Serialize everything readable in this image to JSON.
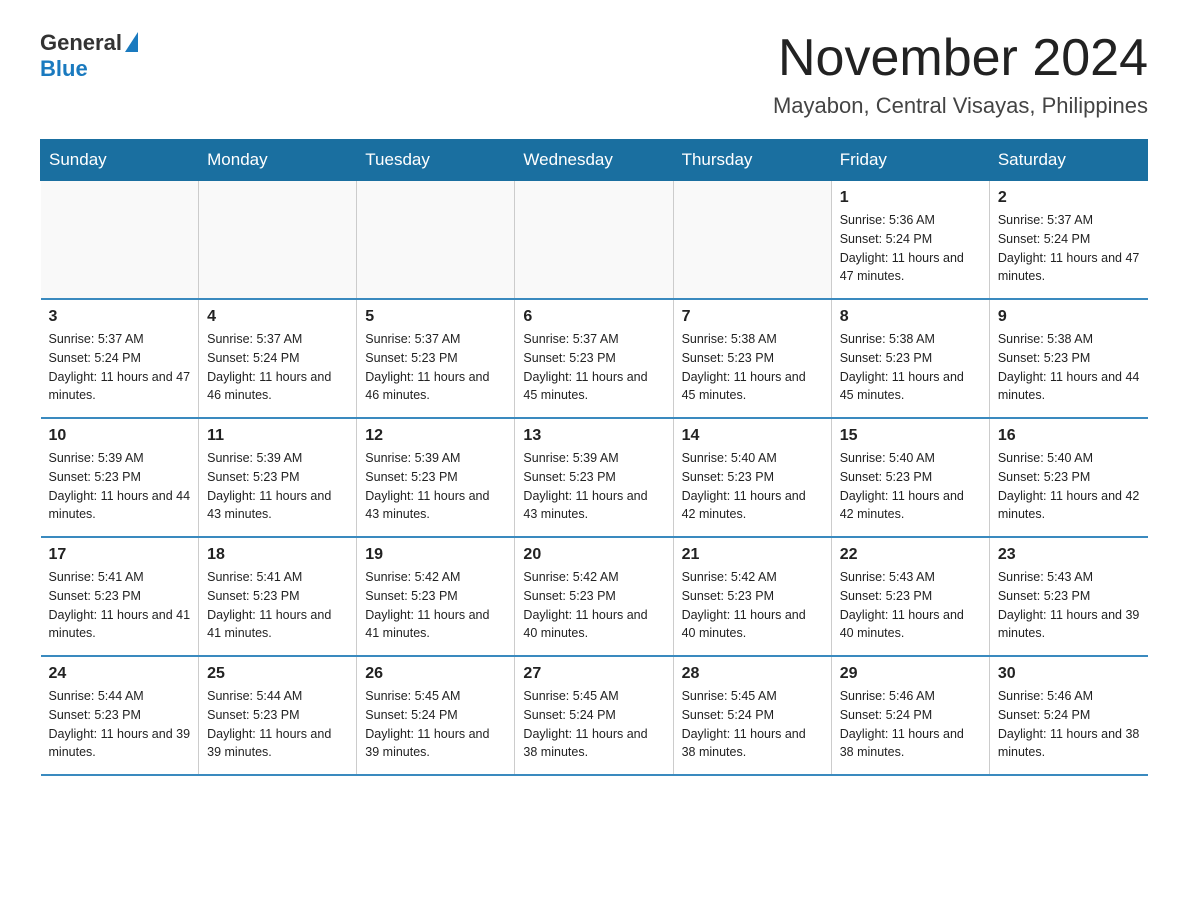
{
  "header": {
    "logo_general": "General",
    "logo_blue": "Blue",
    "month_title": "November 2024",
    "location": "Mayabon, Central Visayas, Philippines"
  },
  "weekdays": [
    "Sunday",
    "Monday",
    "Tuesday",
    "Wednesday",
    "Thursday",
    "Friday",
    "Saturday"
  ],
  "weeks": [
    [
      {
        "day": "",
        "sunrise": "",
        "sunset": "",
        "daylight": ""
      },
      {
        "day": "",
        "sunrise": "",
        "sunset": "",
        "daylight": ""
      },
      {
        "day": "",
        "sunrise": "",
        "sunset": "",
        "daylight": ""
      },
      {
        "day": "",
        "sunrise": "",
        "sunset": "",
        "daylight": ""
      },
      {
        "day": "",
        "sunrise": "",
        "sunset": "",
        "daylight": ""
      },
      {
        "day": "1",
        "sunrise": "Sunrise: 5:36 AM",
        "sunset": "Sunset: 5:24 PM",
        "daylight": "Daylight: 11 hours and 47 minutes."
      },
      {
        "day": "2",
        "sunrise": "Sunrise: 5:37 AM",
        "sunset": "Sunset: 5:24 PM",
        "daylight": "Daylight: 11 hours and 47 minutes."
      }
    ],
    [
      {
        "day": "3",
        "sunrise": "Sunrise: 5:37 AM",
        "sunset": "Sunset: 5:24 PM",
        "daylight": "Daylight: 11 hours and 47 minutes."
      },
      {
        "day": "4",
        "sunrise": "Sunrise: 5:37 AM",
        "sunset": "Sunset: 5:24 PM",
        "daylight": "Daylight: 11 hours and 46 minutes."
      },
      {
        "day": "5",
        "sunrise": "Sunrise: 5:37 AM",
        "sunset": "Sunset: 5:23 PM",
        "daylight": "Daylight: 11 hours and 46 minutes."
      },
      {
        "day": "6",
        "sunrise": "Sunrise: 5:37 AM",
        "sunset": "Sunset: 5:23 PM",
        "daylight": "Daylight: 11 hours and 45 minutes."
      },
      {
        "day": "7",
        "sunrise": "Sunrise: 5:38 AM",
        "sunset": "Sunset: 5:23 PM",
        "daylight": "Daylight: 11 hours and 45 minutes."
      },
      {
        "day": "8",
        "sunrise": "Sunrise: 5:38 AM",
        "sunset": "Sunset: 5:23 PM",
        "daylight": "Daylight: 11 hours and 45 minutes."
      },
      {
        "day": "9",
        "sunrise": "Sunrise: 5:38 AM",
        "sunset": "Sunset: 5:23 PM",
        "daylight": "Daylight: 11 hours and 44 minutes."
      }
    ],
    [
      {
        "day": "10",
        "sunrise": "Sunrise: 5:39 AM",
        "sunset": "Sunset: 5:23 PM",
        "daylight": "Daylight: 11 hours and 44 minutes."
      },
      {
        "day": "11",
        "sunrise": "Sunrise: 5:39 AM",
        "sunset": "Sunset: 5:23 PM",
        "daylight": "Daylight: 11 hours and 43 minutes."
      },
      {
        "day": "12",
        "sunrise": "Sunrise: 5:39 AM",
        "sunset": "Sunset: 5:23 PM",
        "daylight": "Daylight: 11 hours and 43 minutes."
      },
      {
        "day": "13",
        "sunrise": "Sunrise: 5:39 AM",
        "sunset": "Sunset: 5:23 PM",
        "daylight": "Daylight: 11 hours and 43 minutes."
      },
      {
        "day": "14",
        "sunrise": "Sunrise: 5:40 AM",
        "sunset": "Sunset: 5:23 PM",
        "daylight": "Daylight: 11 hours and 42 minutes."
      },
      {
        "day": "15",
        "sunrise": "Sunrise: 5:40 AM",
        "sunset": "Sunset: 5:23 PM",
        "daylight": "Daylight: 11 hours and 42 minutes."
      },
      {
        "day": "16",
        "sunrise": "Sunrise: 5:40 AM",
        "sunset": "Sunset: 5:23 PM",
        "daylight": "Daylight: 11 hours and 42 minutes."
      }
    ],
    [
      {
        "day": "17",
        "sunrise": "Sunrise: 5:41 AM",
        "sunset": "Sunset: 5:23 PM",
        "daylight": "Daylight: 11 hours and 41 minutes."
      },
      {
        "day": "18",
        "sunrise": "Sunrise: 5:41 AM",
        "sunset": "Sunset: 5:23 PM",
        "daylight": "Daylight: 11 hours and 41 minutes."
      },
      {
        "day": "19",
        "sunrise": "Sunrise: 5:42 AM",
        "sunset": "Sunset: 5:23 PM",
        "daylight": "Daylight: 11 hours and 41 minutes."
      },
      {
        "day": "20",
        "sunrise": "Sunrise: 5:42 AM",
        "sunset": "Sunset: 5:23 PM",
        "daylight": "Daylight: 11 hours and 40 minutes."
      },
      {
        "day": "21",
        "sunrise": "Sunrise: 5:42 AM",
        "sunset": "Sunset: 5:23 PM",
        "daylight": "Daylight: 11 hours and 40 minutes."
      },
      {
        "day": "22",
        "sunrise": "Sunrise: 5:43 AM",
        "sunset": "Sunset: 5:23 PM",
        "daylight": "Daylight: 11 hours and 40 minutes."
      },
      {
        "day": "23",
        "sunrise": "Sunrise: 5:43 AM",
        "sunset": "Sunset: 5:23 PM",
        "daylight": "Daylight: 11 hours and 39 minutes."
      }
    ],
    [
      {
        "day": "24",
        "sunrise": "Sunrise: 5:44 AM",
        "sunset": "Sunset: 5:23 PM",
        "daylight": "Daylight: 11 hours and 39 minutes."
      },
      {
        "day": "25",
        "sunrise": "Sunrise: 5:44 AM",
        "sunset": "Sunset: 5:23 PM",
        "daylight": "Daylight: 11 hours and 39 minutes."
      },
      {
        "day": "26",
        "sunrise": "Sunrise: 5:45 AM",
        "sunset": "Sunset: 5:24 PM",
        "daylight": "Daylight: 11 hours and 39 minutes."
      },
      {
        "day": "27",
        "sunrise": "Sunrise: 5:45 AM",
        "sunset": "Sunset: 5:24 PM",
        "daylight": "Daylight: 11 hours and 38 minutes."
      },
      {
        "day": "28",
        "sunrise": "Sunrise: 5:45 AM",
        "sunset": "Sunset: 5:24 PM",
        "daylight": "Daylight: 11 hours and 38 minutes."
      },
      {
        "day": "29",
        "sunrise": "Sunrise: 5:46 AM",
        "sunset": "Sunset: 5:24 PM",
        "daylight": "Daylight: 11 hours and 38 minutes."
      },
      {
        "day": "30",
        "sunrise": "Sunrise: 5:46 AM",
        "sunset": "Sunset: 5:24 PM",
        "daylight": "Daylight: 11 hours and 38 minutes."
      }
    ]
  ]
}
